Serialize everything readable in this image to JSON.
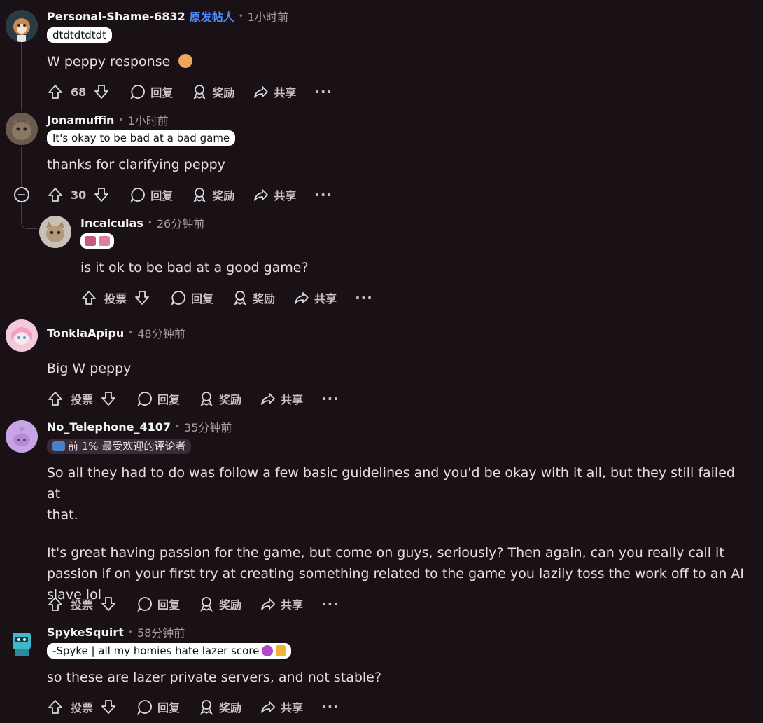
{
  "comments": [
    {
      "author": "Personal-Shame-6832",
      "op_label": "原发帖人",
      "time": "1小时前",
      "flair": "dtdtdtdtdt",
      "body": "W peppy response",
      "votes": "68",
      "reply": "回复",
      "award": "奖励",
      "share": "共享",
      "more": "···"
    },
    {
      "author": "Jonamuffin",
      "time": "1小时前",
      "flair": "It's okay to be bad at a bad game",
      "body": "thanks for clarifying peppy",
      "votes": "30",
      "reply": "回复",
      "award": "奖励",
      "share": "共享",
      "more": "···",
      "collapse": "−"
    },
    {
      "author": "Incalculas",
      "time": "26分钟前",
      "body": "is it ok to be bad at a good game?",
      "votes": "投票",
      "reply": "回复",
      "award": "奖励",
      "share": "共享",
      "more": "···"
    },
    {
      "author": "TonklaApipu",
      "time": "48分钟前",
      "body": "Big W peppy",
      "votes": "投票",
      "reply": "回复",
      "award": "奖励",
      "share": "共享",
      "more": "···"
    },
    {
      "author": "No_Telephone_4107",
      "time": "35分钟前",
      "flair": "前 1% 最受欢迎的评论者",
      "body_lines": [
        "So all they had to do was follow a few basic guidelines and you'd be okay with it all, but they still failed at",
        "that.",
        "",
        "It's great having passion for the game, but come on guys, seriously? Then again, can you really call it",
        "passion if on your first try at creating something related to the game you lazily toss the work off to an AI",
        "slave lol"
      ],
      "votes": "投票",
      "reply": "回复",
      "award": "奖励",
      "share": "共享",
      "more": "···"
    },
    {
      "author": "SpykeSquirt",
      "time": "58分钟前",
      "flair": "-Spyke | all my homies hate lazer score",
      "body": "so these are lazer private servers, and not stable?",
      "votes": "投票",
      "reply": "回复",
      "award": "奖励",
      "share": "共享",
      "more": "···"
    }
  ],
  "colors": {
    "background": "#1a1117",
    "op_blue": "#4d8cff",
    "text": "#e4e0e2"
  }
}
